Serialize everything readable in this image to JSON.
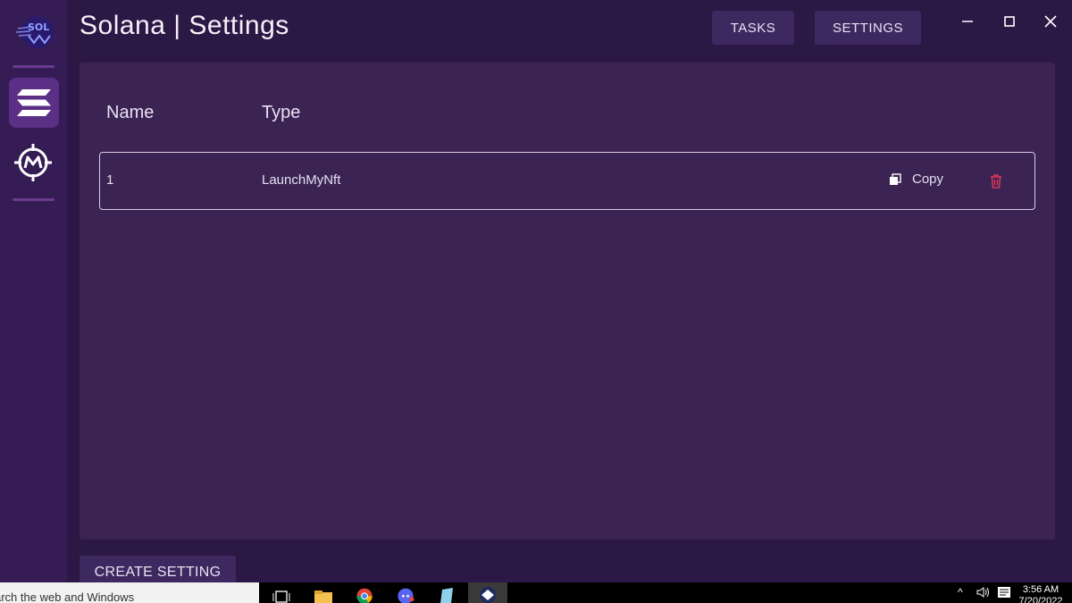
{
  "app": {
    "title": "Solana | Settings"
  },
  "header": {
    "tasks_label": "TASKS",
    "settings_label": "SETTINGS"
  },
  "sidebar": {
    "logo_icon": "sol-ninja-logo",
    "items": [
      {
        "icon": "solana-icon",
        "active": true
      },
      {
        "icon": "magic-eden-icon",
        "active": false
      }
    ]
  },
  "table": {
    "columns": [
      "Name",
      "Type"
    ],
    "rows": [
      {
        "name": "1",
        "type": "LaunchMyNft",
        "copy_label": "Copy"
      }
    ]
  },
  "footer": {
    "create_label": "CREATE SETTING"
  },
  "taskbar": {
    "search_text": "arch the web and Windows",
    "time": "3:56 AM",
    "date": "7/20/2022"
  },
  "colors": {
    "background": "#2c1845",
    "sidebar": "#361c55",
    "panel": "#3b2354",
    "button": "#3e2860",
    "accent": "#5a2f85",
    "delete": "#e0365a"
  }
}
